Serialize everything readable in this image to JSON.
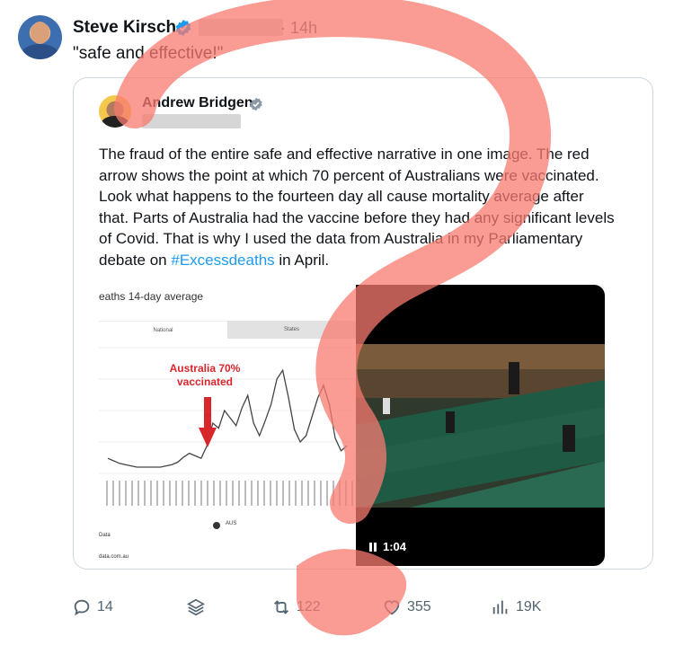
{
  "tweet": {
    "author_name": "Steve Kirsch",
    "time": "· 14h",
    "text": "\"safe and effective!\""
  },
  "quote": {
    "author_name": "Andrew Bridgen",
    "text_before": "The fraud of the entire safe and effective narrative  in one image. The red arrow shows the point at which 70 percent of Australians were vaccinated. Look what happens to the fourteen day all cause mortality average after that. Parts of Australia had the vaccine before they had any significant levels of Covid. That is why I used the data from Australia in my Parliamentary debate on ",
    "hashtag": "#Excessdeaths",
    "text_after": " in April."
  },
  "chart": {
    "title": "eaths 14-day average",
    "tab_national": "National",
    "tab_states": "States",
    "annotation_line1": "Australia 70%",
    "annotation_line2": "vaccinated",
    "legend_label": "AUS",
    "source_line1": "Data",
    "source_line2": "data.com.au",
    "arrow_color": "#d8262d"
  },
  "chart_data": {
    "type": "line",
    "title": "eaths 14-day average",
    "series": [
      {
        "name": "AUS",
        "values": [
          0.12,
          0.1,
          0.08,
          0.07,
          0.06,
          0.05,
          0.05,
          0.05,
          0.05,
          0.05,
          0.06,
          0.07,
          0.09,
          0.13,
          0.16,
          0.14,
          0.12,
          0.22,
          0.4,
          0.36,
          0.5,
          0.44,
          0.38,
          0.52,
          0.62,
          0.4,
          0.3,
          0.42,
          0.55,
          0.75,
          0.82,
          0.6,
          0.35,
          0.25,
          0.3,
          0.45,
          0.6,
          0.7,
          0.55,
          0.28,
          0.18,
          0.22
        ]
      }
    ]
  },
  "video": {
    "duration": "1:04"
  },
  "actions": {
    "replies": "14",
    "retweets": "122",
    "likes": "355",
    "views": "19K"
  },
  "colors": {
    "hashtag": "#1d9bf0",
    "verified": "#1d9bf0",
    "overlay_question_mark": "#f87a70"
  }
}
